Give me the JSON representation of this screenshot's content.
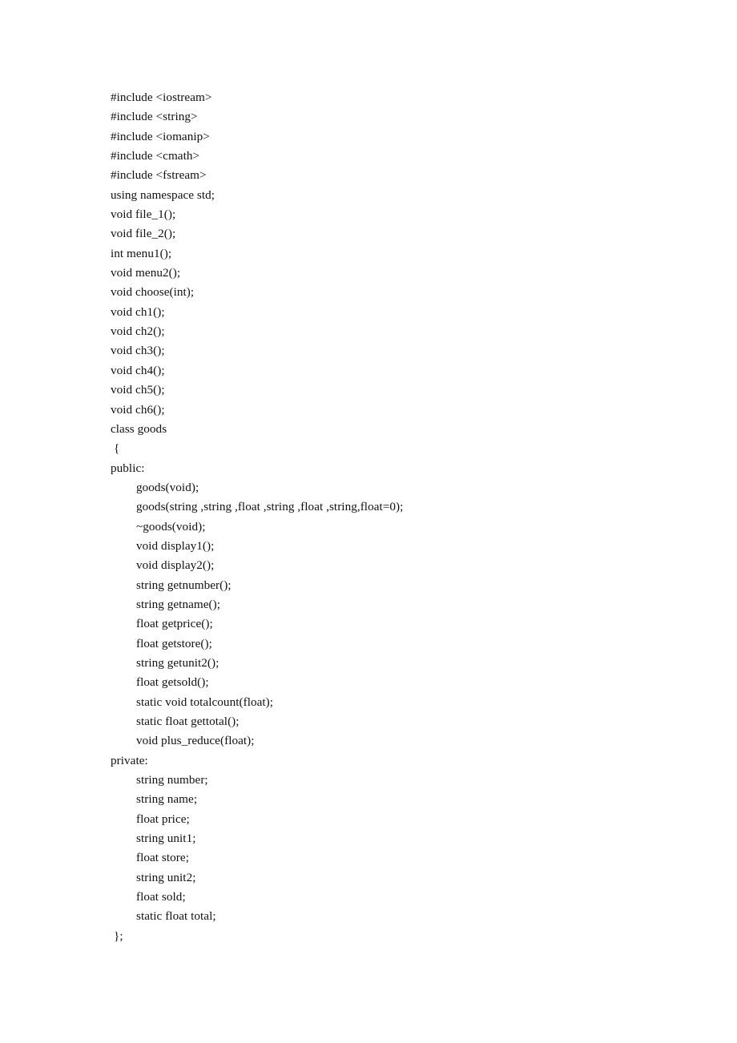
{
  "document": {
    "kind": "source-code-listing",
    "language": "C++",
    "background_color": "#ffffff",
    "text_color": "#111111",
    "lines": [
      {
        "text": "#include <iostream>",
        "indent": 0
      },
      {
        "text": "#include <string>",
        "indent": 0
      },
      {
        "text": "#include <iomanip>",
        "indent": 0
      },
      {
        "text": "#include <cmath>",
        "indent": 0
      },
      {
        "text": "#include <fstream>",
        "indent": 0
      },
      {
        "text": "using namespace std;",
        "indent": 0
      },
      {
        "text": "void file_1();",
        "indent": 0
      },
      {
        "text": "void file_2();",
        "indent": 0
      },
      {
        "text": "int menu1();",
        "indent": 0
      },
      {
        "text": "void menu2();",
        "indent": 0
      },
      {
        "text": "void choose(int);",
        "indent": 0
      },
      {
        "text": "void ch1();",
        "indent": 0
      },
      {
        "text": "void ch2();",
        "indent": 0
      },
      {
        "text": "void ch3();",
        "indent": 0
      },
      {
        "text": "void ch4();",
        "indent": 0
      },
      {
        "text": "void ch5();",
        "indent": 0
      },
      {
        "text": "void ch6();",
        "indent": 0
      },
      {
        "text": "class goods",
        "indent": 0
      },
      {
        "text": "{",
        "indent": 0,
        "brace": true
      },
      {
        "text": "public:",
        "indent": 0
      },
      {
        "text": "goods(void);",
        "indent": 1
      },
      {
        "text": "goods(string ,string ,float ,string ,float ,string,float=0);",
        "indent": 1
      },
      {
        "text": "~goods(void);",
        "indent": 1
      },
      {
        "text": "void display1();",
        "indent": 1
      },
      {
        "text": "void display2();",
        "indent": 1
      },
      {
        "text": "string getnumber();",
        "indent": 1
      },
      {
        "text": "string getname();",
        "indent": 1
      },
      {
        "text": "float getprice();",
        "indent": 1
      },
      {
        "text": "float getstore();",
        "indent": 1
      },
      {
        "text": "string getunit2();",
        "indent": 1
      },
      {
        "text": "float getsold();",
        "indent": 1
      },
      {
        "text": "static void totalcount(float);",
        "indent": 1
      },
      {
        "text": "static float gettotal();",
        "indent": 1
      },
      {
        "text": "void plus_reduce(float);",
        "indent": 1
      },
      {
        "text": "private:",
        "indent": 0
      },
      {
        "text": "string number;",
        "indent": 1
      },
      {
        "text": "string name;",
        "indent": 1
      },
      {
        "text": "float price;",
        "indent": 1
      },
      {
        "text": "string unit1;",
        "indent": 1
      },
      {
        "text": "float store;",
        "indent": 1
      },
      {
        "text": "string unit2;",
        "indent": 1
      },
      {
        "text": "float sold;",
        "indent": 1
      },
      {
        "text": "static float total;",
        "indent": 1
      },
      {
        "text": "};",
        "indent": 0,
        "brace": true
      }
    ]
  }
}
